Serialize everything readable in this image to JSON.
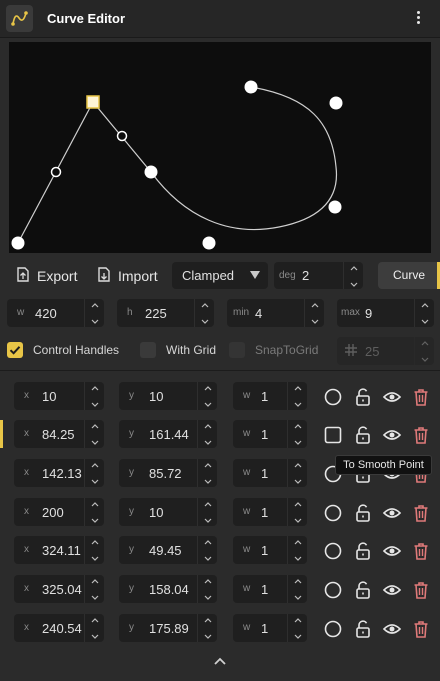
{
  "header": {
    "title": "Curve Editor",
    "app_icon": "curve-icon",
    "menu_icon": "kebab-menu-icon"
  },
  "toolbar": {
    "export_label": "Export",
    "import_label": "Import",
    "interpolation": "Clamped",
    "degree_label": "deg",
    "degree_value": "2",
    "mode_label": "Curve"
  },
  "dimensions": [
    {
      "label": "w",
      "value": "420"
    },
    {
      "label": "h",
      "value": "225"
    },
    {
      "label": "min",
      "value": "4"
    },
    {
      "label": "max",
      "value": "9"
    }
  ],
  "options": {
    "control_handles": {
      "label": "Control Handles",
      "checked": true
    },
    "with_grid": {
      "label": "With Grid",
      "checked": false
    },
    "snap_to_grid": {
      "label": "SnapToGrid",
      "checked": false,
      "disabled": true
    },
    "grid_size": "25"
  },
  "points": [
    {
      "x": "10",
      "y": "10",
      "w": "1",
      "shape": "circle"
    },
    {
      "x": "84.25",
      "y": "161.44",
      "w": "1",
      "shape": "square",
      "selected": true
    },
    {
      "x": "142.13",
      "y": "85.72",
      "w": "1",
      "shape": "circle"
    },
    {
      "x": "200",
      "y": "10",
      "w": "1",
      "shape": "circle"
    },
    {
      "x": "324.11",
      "y": "49.45",
      "w": "1",
      "shape": "circle"
    },
    {
      "x": "325.04",
      "y": "158.04",
      "w": "1",
      "shape": "circle"
    },
    {
      "x": "240.54",
      "y": "175.89",
      "w": "1",
      "shape": "circle"
    }
  ],
  "field_labels": {
    "x": "x",
    "y": "y",
    "w": "w"
  },
  "tooltip": "To Smooth Point",
  "colors": {
    "accent": "#e8c547",
    "delete": "#e07a7a",
    "canvas": "#0d0d0d",
    "panel": "#2b2b2b"
  }
}
